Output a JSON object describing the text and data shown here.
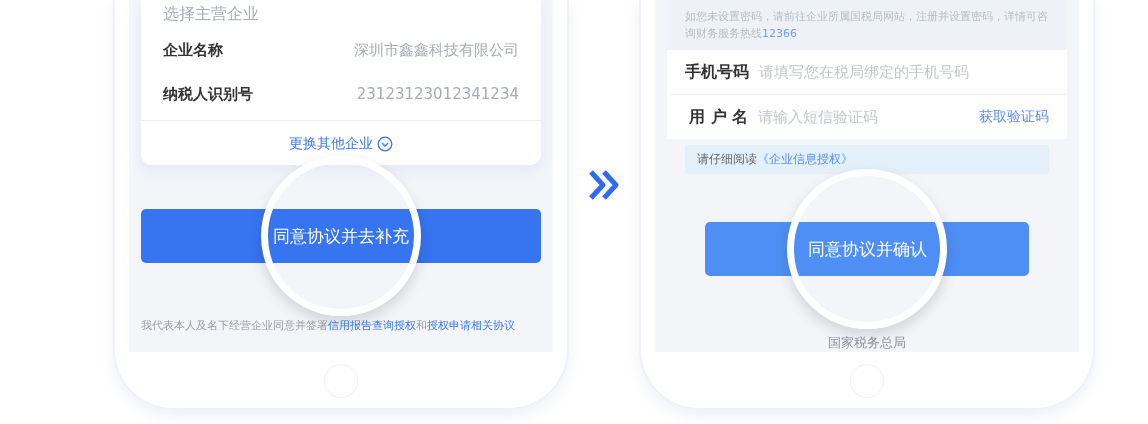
{
  "phones": [
    {
      "kind": "company",
      "heading": "选择主营企业",
      "fields": [
        {
          "label": "企业名称",
          "value": "深圳市鑫鑫科技有限公司"
        },
        {
          "label": "纳税人识别号",
          "value": "23123123012341234"
        }
      ],
      "switch_link": "更换其他企业",
      "button": "同意协议并去补充",
      "agreement": [
        {
          "text": "我代表本人及名下经营企业同意并签署",
          "link": false
        },
        {
          "text": "信用报告查询授权",
          "link": true
        },
        {
          "text": "和",
          "link": false
        },
        {
          "text": "授权申请相关协议",
          "link": true
        }
      ]
    },
    {
      "kind": "login",
      "notice": {
        "text": "如您未设置密码，请前往企业所属国税局网站，注册并设置密码，详情可咨询财务服务热线",
        "hotline": "12366"
      },
      "fields": [
        {
          "label": "手机号码",
          "placeholder": "请填写您在税局绑定的手机号码"
        },
        {
          "label": "用 户 名",
          "placeholder": "请输入短信验证码",
          "action": "获取验证码"
        }
      ],
      "reading": {
        "text": "请仔细阅读",
        "link": "《企业信息授权》"
      },
      "button": "同意协议并确认",
      "footer": "国家税务总局"
    }
  ]
}
